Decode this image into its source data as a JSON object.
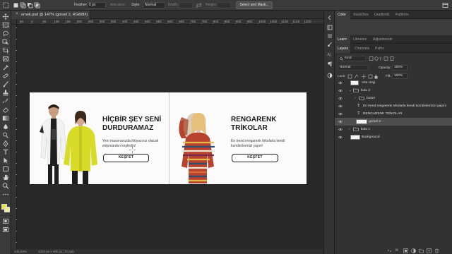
{
  "options_bar": {
    "feather_label": "Feather:",
    "feather_value": "0 px",
    "anti_alias_label": "Anti-alias",
    "style_label": "Style:",
    "style_value": "Normal",
    "width_label": "Width:",
    "height_label": "Height:",
    "select_mask_label": "Select and Mask..."
  },
  "document": {
    "tab_title": "ornek.psd @ 147% (gorsel 2, RGB/8#)",
    "zoom_status": "146,63%",
    "size_status": "1200 px x 400 px (72 ppi)"
  },
  "ruler": {
    "ticks": [
      "50",
      "0",
      "50",
      "100",
      "150",
      "200",
      "250",
      "300",
      "350",
      "400",
      "450",
      "500",
      "550",
      "600",
      "650",
      "700",
      "750",
      "800",
      "850",
      "900",
      "950",
      "1000",
      "1050",
      "1100",
      "1150",
      "1200"
    ]
  },
  "banner_left": {
    "title_line1": "HİÇBİR ŞEY SENİ",
    "title_line2": "DURDURAMAZ",
    "body": "Yeni maceranızda ihtiyacınız olacak ekipmanları keşfedin!",
    "button": "KEŞFET"
  },
  "banner_right": {
    "title_line1": "RENGARENK",
    "title_line2": "TRİKOLAR",
    "body": "En trend rengarenk trikolarla kendi kombinlerinizi yapın!",
    "button": "KEŞFET"
  },
  "panels": {
    "top_tabs": [
      "Color",
      "Swatches",
      "Gradients",
      "Patterns"
    ],
    "mid_tabs": [
      "Learn",
      "Libraries",
      "Adjustments"
    ],
    "layer_tabs": [
      "Layers",
      "Channels",
      "Paths"
    ],
    "kind_label": "Kind",
    "blend_mode": "Normal",
    "opacity_label": "Opacity:",
    "opacity_value": "100%",
    "lock_label": "Lock:",
    "fill_label": "Fill:",
    "fill_value": "100%"
  },
  "layers": [
    {
      "name": "orta cizgi",
      "type": "shape",
      "indent": 0
    },
    {
      "name": "kutu 2",
      "type": "group-open",
      "indent": 0
    },
    {
      "name": "buton",
      "type": "group-closed",
      "indent": 1
    },
    {
      "name": "En trend rengarenk trikolarla kendi kombinlerinizi yapın!",
      "type": "text",
      "indent": 1
    },
    {
      "name": "RENGARENK TRİKOLAR",
      "type": "text",
      "indent": 1
    },
    {
      "name": "gorsel 2",
      "type": "image",
      "indent": 1,
      "selected": true
    },
    {
      "name": "kutu 1",
      "type": "group-closed",
      "indent": 0
    },
    {
      "name": "Background",
      "type": "background",
      "indent": 0
    }
  ],
  "colors": {
    "panel_bg": "#323232",
    "canvas_bg": "#fbfbfb",
    "foreground_swatch": "#e8e23a",
    "background_swatch": "#f2ec9a",
    "selected_layer": "#4e4e4e"
  }
}
